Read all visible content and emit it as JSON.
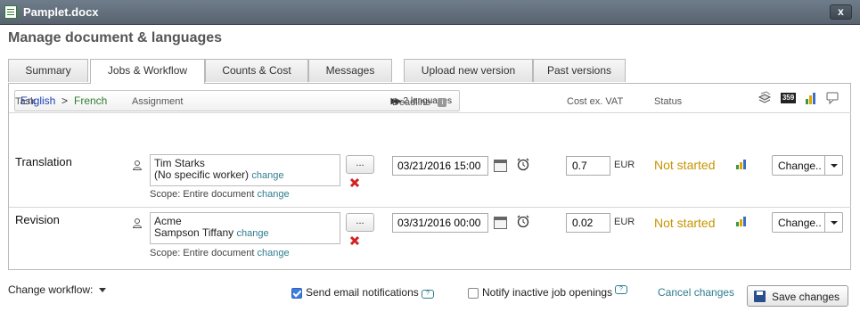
{
  "window": {
    "title": "Pamplet.docx",
    "close_label": "x"
  },
  "heading": "Manage document & languages",
  "tabs": [
    {
      "label": "Summary",
      "active": false
    },
    {
      "label": "Jobs & Workflow",
      "active": true
    },
    {
      "label": "Counts & Cost",
      "active": false
    },
    {
      "label": "Messages",
      "active": false
    },
    {
      "label": "Upload new version",
      "active": false
    },
    {
      "label": "Past versions",
      "active": false
    }
  ],
  "languages": {
    "source": "English",
    "separator": ">",
    "target": "French",
    "count_label": "2 languages"
  },
  "toolbar_icons": [
    "stack-icon",
    "359-badge-icon",
    "bar-chart-icon",
    "comment-icon"
  ],
  "toolbar_badge": "359",
  "columns": {
    "task": "Task",
    "assignment": "Assignment",
    "deadline": "Deadline",
    "cost": "Cost ex. VAT",
    "status": "Status"
  },
  "jobs": [
    {
      "task": "Translation",
      "assignee_line1": "Tim Starks",
      "assignee_line2": "(No specific worker)",
      "change_link": "change",
      "browse_label": "...",
      "scope_label": "Scope: Entire document",
      "scope_change": "change",
      "deadline": "03/21/2016 15:00",
      "cost": "0.7",
      "currency": "EUR",
      "status": "Not started",
      "action_label": "Change.."
    },
    {
      "task": "Revision",
      "assignee_line1": "Acme",
      "assignee_line2": "Sampson Tiffany",
      "change_link": "change",
      "browse_label": "...",
      "scope_label": "Scope: Entire document",
      "scope_change": "change",
      "deadline": "03/31/2016 00:00",
      "cost": "0.02",
      "currency": "EUR",
      "status": "Not started",
      "action_label": "Change.."
    }
  ],
  "footer": {
    "workflow_label": "Change workflow:",
    "email_notify_label": "Send email notifications",
    "email_notify_checked": true,
    "inactive_notify_label": "Notify inactive job openings",
    "inactive_notify_checked": false,
    "help_label": "?",
    "cancel_label": "Cancel changes",
    "save_label": "Save changes"
  },
  "colors": {
    "titlebar": "#5f6b78",
    "source_lang": "#1a3fb7",
    "target_lang": "#2e7d32",
    "status": "#c79400",
    "link": "#2e7d8e"
  }
}
